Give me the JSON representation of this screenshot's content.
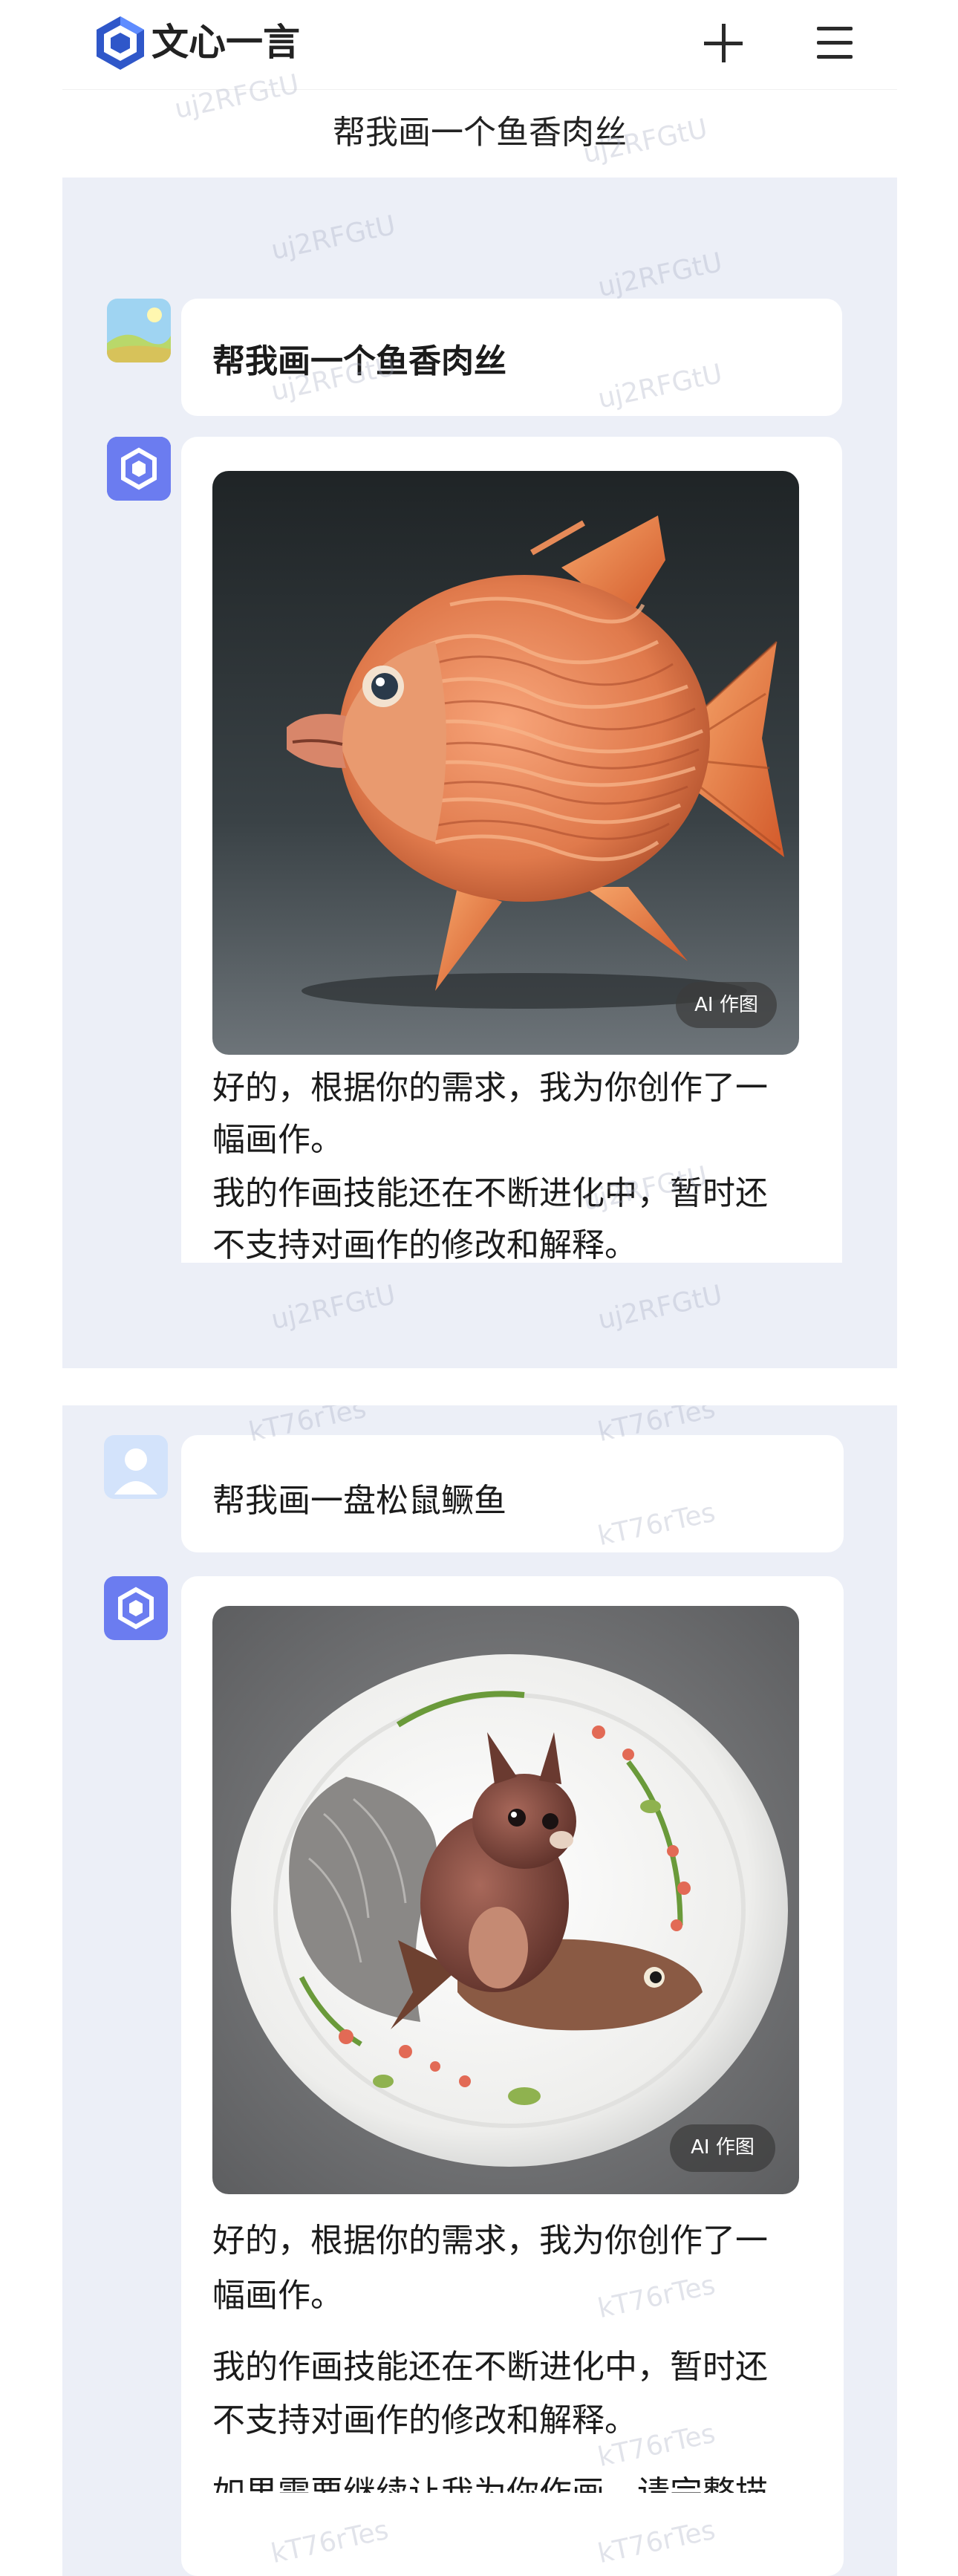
{
  "app": {
    "title": "文心一言",
    "accent": "#4f6fe0"
  },
  "header": {
    "conversation_title": "帮我画一个鱼香肉丝",
    "new_chat_icon": "plus-icon",
    "menu_icon": "hamburger-menu-icon"
  },
  "conversation_1": {
    "user_prompt": "帮我画一个鱼香肉丝",
    "image_badge": "AI 作图",
    "reply_lines": [
      "好的，根据你的需求，我为你创作了一",
      "幅画作。",
      "我的作画技能还在不断进化中，暂时还",
      "不支持对画作的修改和解释。"
    ]
  },
  "conversation_2": {
    "user_prompt": "帮我画一盘松鼠鳜鱼",
    "image_badge": "AI 作图",
    "reply_lines": [
      "好的，根据你的需求，我为你创作了一",
      "幅画作。",
      "我的作画技能还在不断进化中，暂时还",
      "不支持对画作的修改和解释。",
      "如果需要继续让我为你作画，请完整描"
    ]
  },
  "watermarks": {
    "panel1": "uj2RFGtU",
    "panel2": "kT76rTes"
  }
}
